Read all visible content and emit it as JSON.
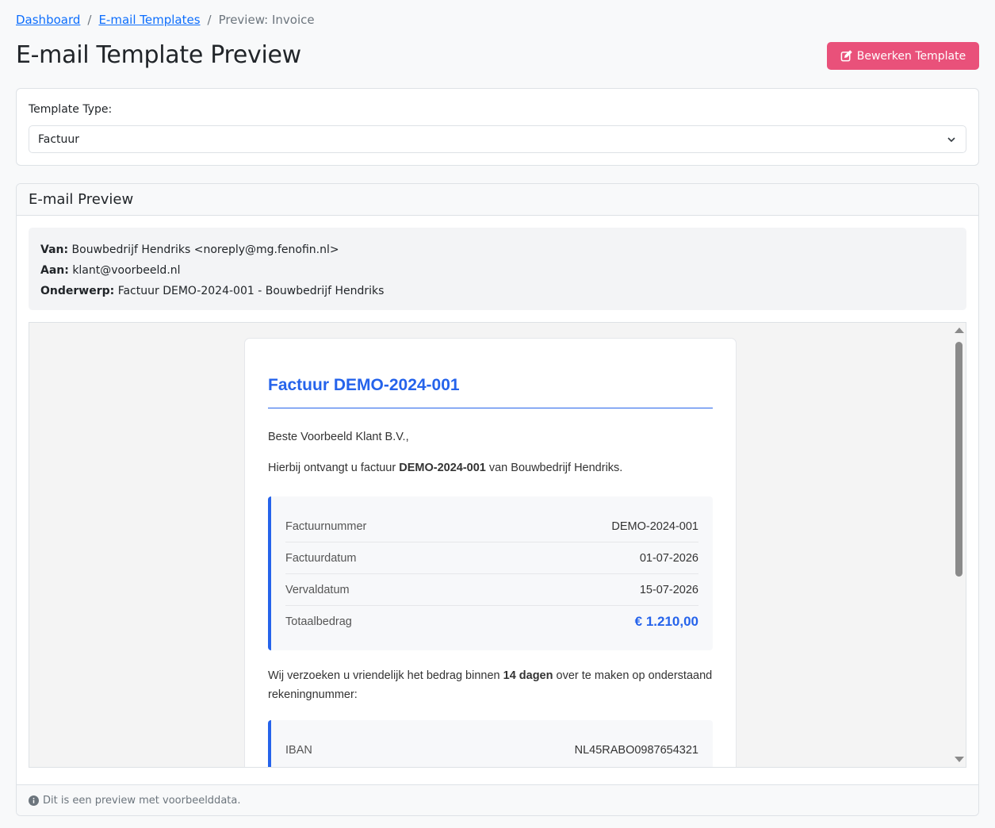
{
  "breadcrumb": {
    "items": [
      {
        "label": "Dashboard"
      },
      {
        "label": "E-mail Templates"
      }
    ],
    "separator": "/",
    "current": "Preview: Invoice"
  },
  "header": {
    "title": "E-mail Template Preview",
    "edit_label": "Bewerken Template"
  },
  "template_type": {
    "label": "Template Type:",
    "selected": "Factuur"
  },
  "preview": {
    "title": "E-mail Preview",
    "meta": {
      "from_label": "Van:",
      "from_value": "Bouwbedrijf Hendriks <noreply@mg.fenofin.nl>",
      "to_label": "Aan:",
      "to_value": "klant@voorbeeld.nl",
      "subject_label": "Onderwerp:",
      "subject_value": "Factuur DEMO-2024-001 - Bouwbedrijf Hendriks"
    },
    "email": {
      "heading": "Factuur DEMO-2024-001",
      "greeting": "Beste Voorbeeld Klant B.V.,",
      "intro_pre": "Hierbij ontvangt u factuur ",
      "intro_bold": "DEMO-2024-001",
      "intro_post": " van Bouwbedrijf Hendriks.",
      "details": [
        {
          "label": "Factuurnummer",
          "value": "DEMO-2024-001"
        },
        {
          "label": "Factuurdatum",
          "value": "01-07-2026"
        },
        {
          "label": "Vervaldatum",
          "value": "15-07-2026"
        },
        {
          "label": "Totaalbedrag",
          "value": "€ 1.210,00"
        }
      ],
      "pay_pre": "Wij verzoeken u vriendelijk het bedrag binnen ",
      "pay_bold": "14 dagen",
      "pay_post": " over te maken op onderstaand rekeningnummer:",
      "bank": [
        {
          "label": "IBAN",
          "value": "NL45RABO0987654321"
        }
      ]
    },
    "footer_note": "Dit is een preview met voorbeelddata."
  },
  "colors": {
    "accent_blue": "#2563eb",
    "edit_button": "#e9517a",
    "link": "#0d6efd"
  },
  "icons": {
    "edit": "edit-icon",
    "chevron": "chevron-down-icon",
    "info": "info-circle-icon"
  }
}
